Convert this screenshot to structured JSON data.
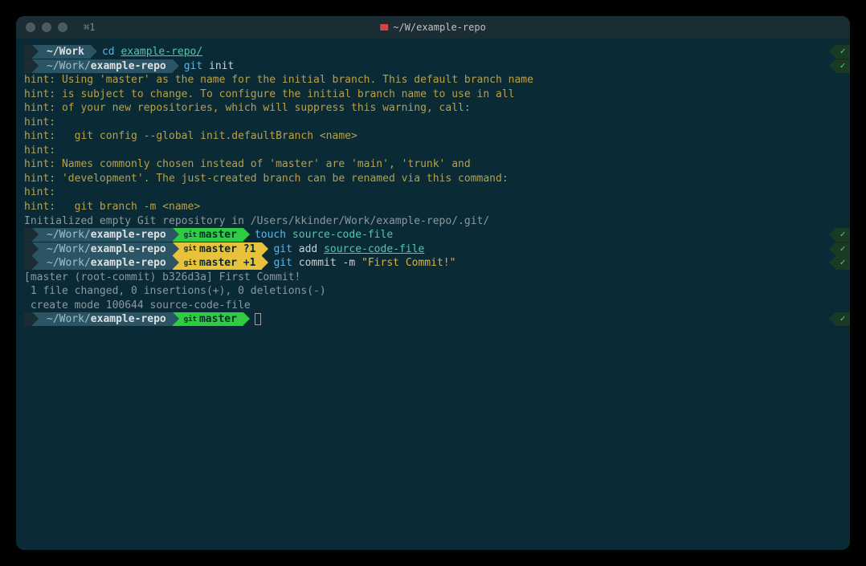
{
  "window": {
    "tab_label": "⌘1",
    "title": "~/W/example-repo"
  },
  "prompts": {
    "p1": {
      "path": "~/Work",
      "cmd_cd": "cd",
      "cmd_arg": "example-repo/"
    },
    "p2": {
      "path_dim": "~/Work/",
      "path_bold": "example-repo",
      "cmd": "git",
      "cmd_arg": "init"
    },
    "p3": {
      "path_dim": "~/Work/",
      "path_bold": "example-repo",
      "branch": "master",
      "cmd": "touch",
      "cmd_arg": "source-code-file"
    },
    "p4": {
      "path_dim": "~/Work/",
      "path_bold": "example-repo",
      "branch": "master ?1",
      "cmd": "git",
      "cmd_sub": "add",
      "cmd_arg": "source-code-file"
    },
    "p5": {
      "path_dim": "~/Work/",
      "path_bold": "example-repo",
      "branch": "master +1",
      "cmd": "git",
      "cmd_sub": "commit",
      "cmd_flag": "-m",
      "cmd_str": "\"First Commit!\""
    },
    "p6": {
      "path_dim": "~/Work/",
      "path_bold": "example-repo",
      "branch": "master"
    }
  },
  "hints": {
    "h1": "hint: Using 'master' as the name for the initial branch. This default branch name",
    "h2": "hint: is subject to change. To configure the initial branch name to use in all",
    "h3": "hint: of your new repositories, which will suppress this warning, call:",
    "h4": "hint:",
    "h5": "hint:   git config --global init.defaultBranch <name>",
    "h6": "hint:",
    "h7": "hint: Names commonly chosen instead of 'master' are 'main', 'trunk' and",
    "h8": "hint: 'development'. The just-created branch can be renamed via this command:",
    "h9": "hint:",
    "h10": "hint:   git branch -m <name>"
  },
  "output": {
    "init": "Initialized empty Git repository in /Users/kkinder/Work/example-repo/.git/",
    "commit1": "[master (root-commit) b326d3a] First Commit!",
    "commit2": " 1 file changed, 0 insertions(+), 0 deletions(-)",
    "commit3": " create mode 100644 source-code-file"
  },
  "glyphs": {
    "apple": "",
    "folder": "",
    "check": "✓",
    "git": "git"
  }
}
